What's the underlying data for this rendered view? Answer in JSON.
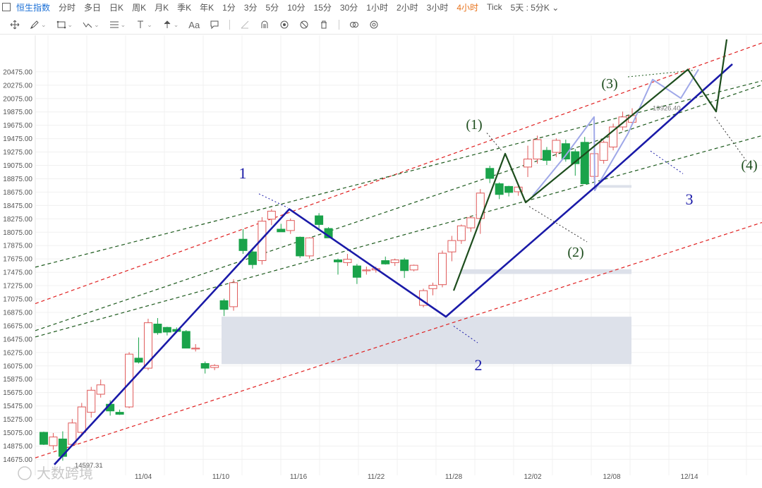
{
  "top_tabs": [
    {
      "label": "恒生指数",
      "state": "active"
    },
    {
      "label": "分时",
      "state": ""
    },
    {
      "label": "多日",
      "state": ""
    },
    {
      "label": "日K",
      "state": ""
    },
    {
      "label": "周K",
      "state": ""
    },
    {
      "label": "月K",
      "state": ""
    },
    {
      "label": "季K",
      "state": ""
    },
    {
      "label": "年K",
      "state": ""
    },
    {
      "label": "1分",
      "state": ""
    },
    {
      "label": "3分",
      "state": ""
    },
    {
      "label": "5分",
      "state": ""
    },
    {
      "label": "10分",
      "state": ""
    },
    {
      "label": "15分",
      "state": ""
    },
    {
      "label": "30分",
      "state": ""
    },
    {
      "label": "1小时",
      "state": ""
    },
    {
      "label": "2小时",
      "state": ""
    },
    {
      "label": "3小时",
      "state": ""
    },
    {
      "label": "4小时",
      "state": "orange"
    },
    {
      "label": "Tick",
      "state": ""
    },
    {
      "label": "5天 : 5分K ⌄",
      "state": ""
    }
  ],
  "toolbar": {
    "text_tool": "Aa",
    "icons": [
      "move-icon",
      "pen-icon",
      "rectangle-icon",
      "trend-line-icon",
      "fibonacci-icon",
      "vertical-line-icon",
      "arrow-up-icon",
      "text-icon",
      "comment-icon",
      "ruler-icon",
      "magnet-icon",
      "eye-icon",
      "hide-icon",
      "trash-icon",
      "link-icon",
      "settings-icon"
    ]
  },
  "chart_data": {
    "type": "candlestick",
    "y_ticks": [
      "20475.00",
      "20275.00",
      "20075.00",
      "19875.00",
      "19675.00",
      "19475.00",
      "19275.00",
      "19075.00",
      "18875.00",
      "18675.00",
      "18475.00",
      "18275.00",
      "18075.00",
      "17875.00",
      "17675.00",
      "17475.00",
      "17275.00",
      "17075.00",
      "16875.00",
      "16675.00",
      "16475.00",
      "16275.00",
      "16075.00",
      "15875.00",
      "15675.00",
      "15475.00",
      "15275.00",
      "15075.00",
      "14875.00",
      "14675.00"
    ],
    "ylim": [
      14500,
      20980
    ],
    "x_ticks": [
      "11/04",
      "11/10",
      "11/16",
      "11/22",
      "11/28",
      "12/02",
      "12/08",
      "12/14"
    ],
    "low_label": "14597.31",
    "high_label": "19926.40",
    "watermark": "大数跨境",
    "colors": {
      "up": "#e05a5a",
      "down": "#1aa34a",
      "wave": "#1a1aa8",
      "sub_wave": "#1d4d1d",
      "projection": "#9fa8e8",
      "channel_red": "#e02020",
      "channel_green": "#1d5a1d",
      "zone": "#dde1ea"
    },
    "candles": [
      {
        "o": 15080,
        "h": 15090,
        "l": 14890,
        "c": 14900
      },
      {
        "o": 14880,
        "h": 15070,
        "l": 14820,
        "c": 15010
      },
      {
        "o": 14980,
        "h": 15095,
        "l": 14655,
        "c": 14720
      },
      {
        "o": 14900,
        "h": 15280,
        "l": 14880,
        "c": 15220
      },
      {
        "o": 15080,
        "h": 15520,
        "l": 15020,
        "c": 15460
      },
      {
        "o": 15380,
        "h": 15760,
        "l": 15300,
        "c": 15710
      },
      {
        "o": 15650,
        "h": 15870,
        "l": 15600,
        "c": 15790
      },
      {
        "o": 15500,
        "h": 15560,
        "l": 15330,
        "c": 15400
      },
      {
        "o": 15380,
        "h": 15420,
        "l": 15340,
        "c": 15350
      },
      {
        "o": 15460,
        "h": 16280,
        "l": 15440,
        "c": 16250
      },
      {
        "o": 16190,
        "h": 16500,
        "l": 16110,
        "c": 16130
      },
      {
        "o": 16040,
        "h": 16780,
        "l": 16010,
        "c": 16720
      },
      {
        "o": 16700,
        "h": 16790,
        "l": 16540,
        "c": 16570
      },
      {
        "o": 16650,
        "h": 16660,
        "l": 16530,
        "c": 16580
      },
      {
        "o": 16620,
        "h": 16650,
        "l": 16570,
        "c": 16590
      },
      {
        "o": 16590,
        "h": 16610,
        "l": 16380,
        "c": 16340
      },
      {
        "o": 16330,
        "h": 16400,
        "l": 16290,
        "c": 16340
      },
      {
        "o": 16110,
        "h": 16140,
        "l": 15960,
        "c": 16040
      },
      {
        "o": 16050,
        "h": 16100,
        "l": 16010,
        "c": 16080
      },
      {
        "o": 17050,
        "h": 17080,
        "l": 16820,
        "c": 16920
      },
      {
        "o": 16960,
        "h": 17370,
        "l": 16900,
        "c": 17320
      },
      {
        "o": 17970,
        "h": 18120,
        "l": 17750,
        "c": 17800
      },
      {
        "o": 17780,
        "h": 17840,
        "l": 17530,
        "c": 17590
      },
      {
        "o": 17650,
        "h": 18300,
        "l": 17590,
        "c": 18240
      },
      {
        "o": 18270,
        "h": 18420,
        "l": 18180,
        "c": 18390
      },
      {
        "o": 18120,
        "h": 18200,
        "l": 18080,
        "c": 18080
      },
      {
        "o": 18100,
        "h": 18280,
        "l": 18050,
        "c": 18250
      },
      {
        "o": 18000,
        "h": 18010,
        "l": 17690,
        "c": 17720
      },
      {
        "o": 17720,
        "h": 18000,
        "l": 17680,
        "c": 17990
      },
      {
        "o": 18320,
        "h": 18360,
        "l": 18120,
        "c": 18190
      },
      {
        "o": 18130,
        "h": 18150,
        "l": 17990,
        "c": 17990
      },
      {
        "o": 17660,
        "h": 17680,
        "l": 17440,
        "c": 17630
      },
      {
        "o": 17620,
        "h": 17750,
        "l": 17570,
        "c": 17670
      },
      {
        "o": 17570,
        "h": 17600,
        "l": 17300,
        "c": 17400
      },
      {
        "o": 17500,
        "h": 17560,
        "l": 17440,
        "c": 17510
      },
      {
        "o": 17510,
        "h": 17560,
        "l": 17470,
        "c": 17530
      },
      {
        "o": 17650,
        "h": 17710,
        "l": 17590,
        "c": 17600
      },
      {
        "o": 17620,
        "h": 17680,
        "l": 17570,
        "c": 17660
      },
      {
        "o": 17660,
        "h": 17690,
        "l": 17390,
        "c": 17500
      },
      {
        "o": 17510,
        "h": 17590,
        "l": 17490,
        "c": 17580
      },
      {
        "o": 16980,
        "h": 17230,
        "l": 16950,
        "c": 17200
      },
      {
        "o": 17230,
        "h": 17320,
        "l": 17130,
        "c": 17280
      },
      {
        "o": 17290,
        "h": 17800,
        "l": 17250,
        "c": 17760
      },
      {
        "o": 17780,
        "h": 18020,
        "l": 17640,
        "c": 17950
      },
      {
        "o": 17950,
        "h": 18190,
        "l": 17900,
        "c": 18170
      },
      {
        "o": 18140,
        "h": 18320,
        "l": 18080,
        "c": 18290
      },
      {
        "o": 18280,
        "h": 18720,
        "l": 18050,
        "c": 18660
      },
      {
        "o": 19030,
        "h": 19070,
        "l": 18810,
        "c": 18880
      },
      {
        "o": 18800,
        "h": 18820,
        "l": 18570,
        "c": 18640
      },
      {
        "o": 18760,
        "h": 18770,
        "l": 18610,
        "c": 18670
      },
      {
        "o": 18680,
        "h": 18770,
        "l": 18620,
        "c": 18750
      },
      {
        "o": 19050,
        "h": 19370,
        "l": 18900,
        "c": 19170
      },
      {
        "o": 19170,
        "h": 19520,
        "l": 19100,
        "c": 19460
      },
      {
        "o": 19300,
        "h": 19350,
        "l": 19080,
        "c": 19150
      },
      {
        "o": 19270,
        "h": 19480,
        "l": 19200,
        "c": 19450
      },
      {
        "o": 19400,
        "h": 19460,
        "l": 19130,
        "c": 19170
      },
      {
        "o": 19280,
        "h": 19320,
        "l": 18920,
        "c": 19100
      },
      {
        "o": 19420,
        "h": 19500,
        "l": 18800,
        "c": 18800
      },
      {
        "o": 18910,
        "h": 19280,
        "l": 18860,
        "c": 19250
      },
      {
        "o": 19150,
        "h": 19450,
        "l": 19100,
        "c": 19420
      },
      {
        "o": 19350,
        "h": 19700,
        "l": 19300,
        "c": 19650
      },
      {
        "o": 19650,
        "h": 19880,
        "l": 19600,
        "c": 19800
      },
      {
        "o": 19720,
        "h": 19930,
        "l": 19700,
        "c": 19820
      }
    ],
    "annotations": [
      {
        "text": "1",
        "style": "blue"
      },
      {
        "text": "2",
        "style": "blue"
      },
      {
        "text": "3",
        "style": "blue"
      },
      {
        "text": "(1)",
        "style": "green"
      },
      {
        "text": "(2)",
        "style": "green"
      },
      {
        "text": "(3)",
        "style": "green"
      },
      {
        "text": "(4)",
        "style": "green"
      }
    ]
  }
}
